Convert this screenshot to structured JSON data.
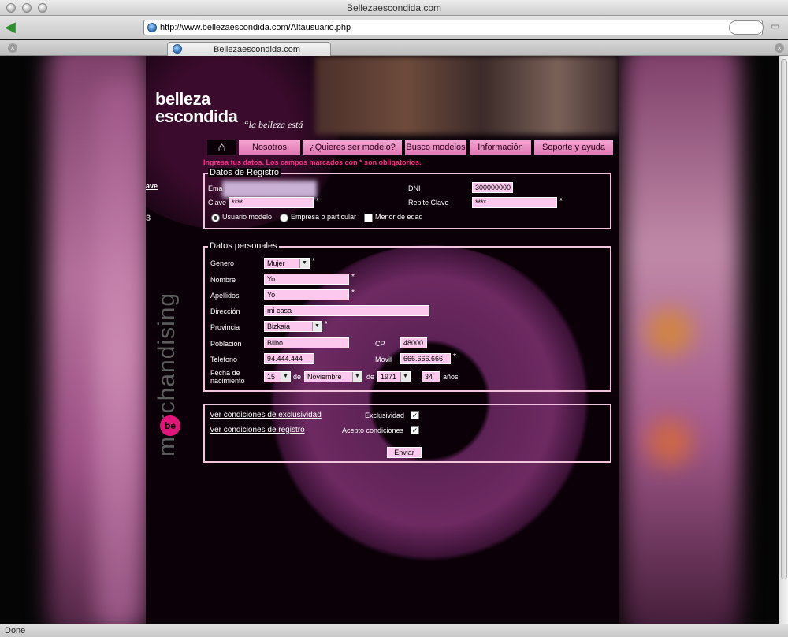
{
  "browser": {
    "window_title": "Bellezaescondida.com",
    "url": "http://www.bellezaescondida.com/Altausuario.php",
    "tab_title": "Bellezaescondida.com",
    "status": "Done",
    "back_icon": "back-arrow-icon"
  },
  "site": {
    "logo_line1": "belleza",
    "logo_line2": "escondida",
    "tagline": "“la belleza está",
    "side_link": "ave",
    "side_char": "3",
    "side_brand": "merchandising",
    "side_logo": "be"
  },
  "nav": {
    "home_icon": "home-icon",
    "items": [
      "Nosotros",
      "¿Quieres ser modelo?",
      "Busco modelos",
      "Información",
      "Soporte y ayuda"
    ]
  },
  "instructions": "Ingresa tus datos. Los campos marcados con * son obligatorios.",
  "registro": {
    "legend": "Datos de Registro",
    "email_label": "Ema",
    "email_value": "",
    "dni_label": "DNI",
    "dni_value": "300000000",
    "clave_label": "Clave",
    "clave_value": "****",
    "repite_label": "Repite Clave",
    "repite_value": "****",
    "radio_usuario": "Usuario modelo",
    "radio_empresa": "Empresa o particular",
    "check_menor": "Menor de edad"
  },
  "personales": {
    "legend": "Datos personales",
    "genero_label": "Genero",
    "genero_value": "Mujer",
    "nombre_label": "Nombre",
    "nombre_value": "Yo",
    "apellidos_label": "Apellidos",
    "apellidos_value": "Yo",
    "direccion_label": "Dirección",
    "direccion_value": "mi casa",
    "provincia_label": "Provincia",
    "provincia_value": "Bizkaia",
    "poblacion_label": "Poblacion",
    "poblacion_value": "Bilbo",
    "cp_label": "CP",
    "cp_value": "48000",
    "telefono_label": "Telefono",
    "telefono_value": "94.444.444",
    "movil_label": "Movil",
    "movil_value": "666.666.666",
    "fecha_label_1": "Fecha de",
    "fecha_label_2": "nacimiento",
    "day_value": "15",
    "de1": "de",
    "month_value": "Noviembre",
    "de2": "de",
    "year_value": "1971",
    "age_value": "34",
    "anos": "años"
  },
  "condiciones": {
    "link_exclusividad": "Ver condiciones de exclusividad",
    "link_registro": "Ver condiciones de registro",
    "exclusividad_label": "Exclusividad",
    "acepto_label": "Acepto condiciones",
    "enviar": "Enviar"
  },
  "required_mark": "*"
}
